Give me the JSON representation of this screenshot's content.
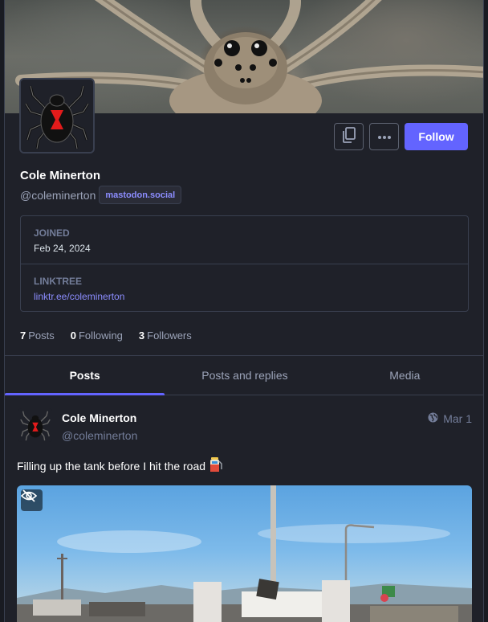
{
  "profile": {
    "display_name": "Cole Minerton",
    "acct": "@coleminerton",
    "domain": "mastodon.social",
    "follow_label": "Follow"
  },
  "fields": [
    {
      "label": "JOINED",
      "value": "Feb 24, 2024"
    },
    {
      "label": "LINKTREE",
      "value": "linktr.ee/coleminerton"
    }
  ],
  "counts": {
    "posts_num": "7",
    "posts_label": "Posts",
    "following_num": "0",
    "following_label": "Following",
    "followers_num": "3",
    "followers_label": "Followers"
  },
  "tabs": [
    {
      "label": "Posts",
      "active": true
    },
    {
      "label": "Posts and replies",
      "active": false
    },
    {
      "label": "Media",
      "active": false
    }
  ],
  "status": {
    "display_name": "Cole Minerton",
    "acct": "@coleminerton",
    "date": "Mar 1",
    "visibility_icon": "globe-icon",
    "text": "Filling up the tank before I hit the road",
    "emoji_icon": "fuel-pump-icon"
  },
  "colors": {
    "accent": "#6364ff",
    "link": "#8c8dff",
    "background": "#191b22",
    "panel": "#1f2129"
  },
  "icons": {
    "copy": "copy-icon",
    "more": "ellipsis-icon",
    "hide_media": "eye-slash-icon"
  }
}
